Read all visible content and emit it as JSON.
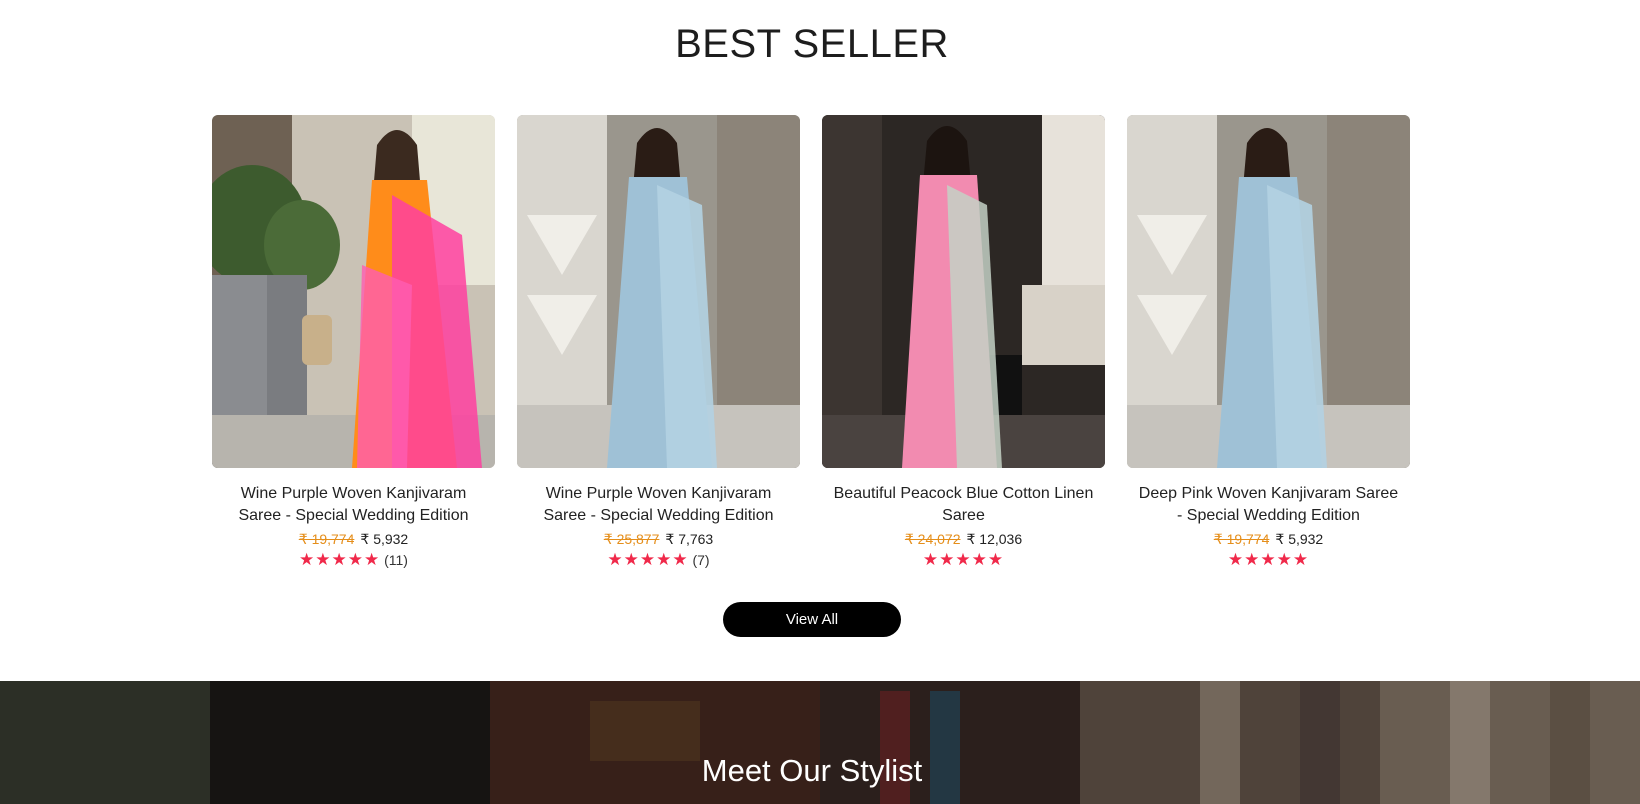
{
  "section": {
    "title": "BEST SELLER"
  },
  "products": [
    {
      "name": "Wine Purple Woven Kanjivaram Saree - Special Wedding Edition",
      "mrp": "₹ 19,774",
      "price": "₹ 5,932",
      "review_count": "(11)",
      "stars": 5
    },
    {
      "name": "Wine Purple Woven Kanjivaram Saree - Special Wedding Edition",
      "mrp": "₹ 25,877",
      "price": "₹ 7,763",
      "review_count": "(7)",
      "stars": 5
    },
    {
      "name": "Beautiful Peacock Blue Cotton Linen Saree",
      "mrp": "₹ 24,072",
      "price": "₹ 12,036",
      "review_count": "",
      "stars": 5
    },
    {
      "name": "Deep Pink Woven Kanjivaram Saree - Special Wedding Edition",
      "mrp": "₹ 19,774",
      "price": "₹ 5,932",
      "review_count": "",
      "stars": 5
    }
  ],
  "view_all": {
    "label": "View All"
  },
  "banner": {
    "title": "Meet Our Stylist"
  },
  "colors": {
    "star": "#f0294a",
    "mrp": "#e58e1a",
    "button": "#000000"
  },
  "icons": {
    "star": "star-icon"
  }
}
